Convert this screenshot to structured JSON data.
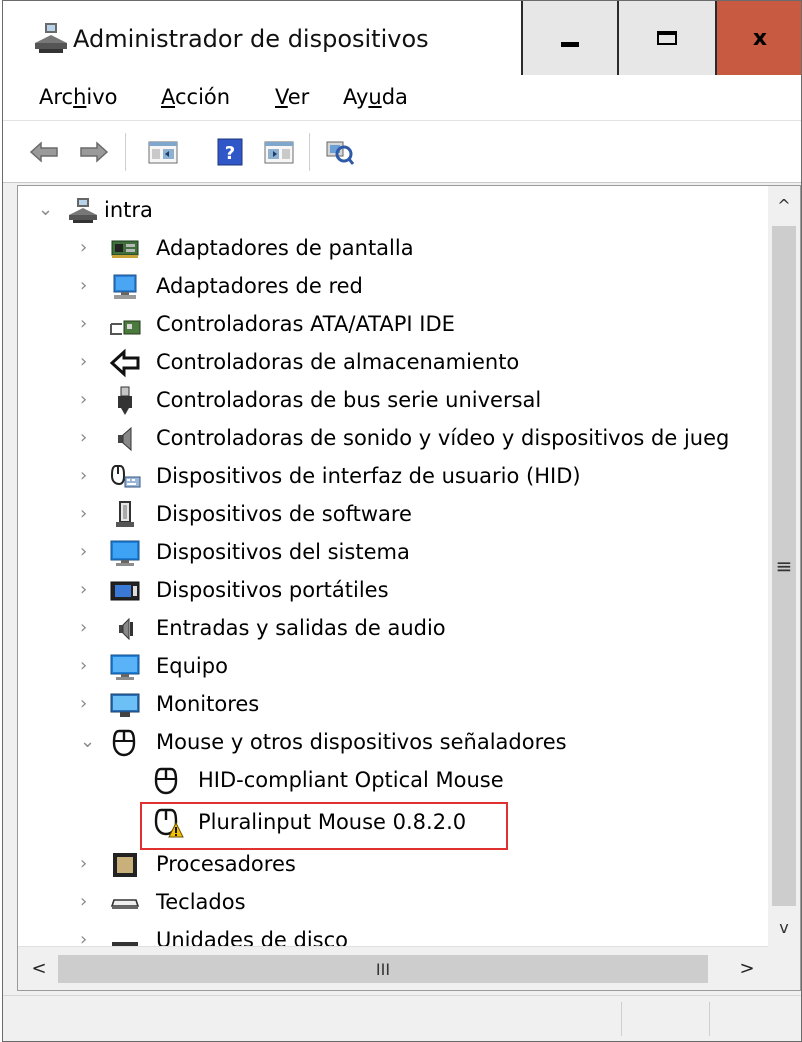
{
  "window": {
    "title": "Administrador de dispositivos",
    "close_glyph": "x",
    "accent_close": "#c75a40"
  },
  "menu": {
    "archivo": {
      "pre": "Arc",
      "u": "h",
      "post": "ivo"
    },
    "accion": {
      "pre": "",
      "u": "A",
      "post": "cción"
    },
    "ver": {
      "pre": "",
      "u": "V",
      "post": "er"
    },
    "ayuda": {
      "pre": "Ay",
      "u": "u",
      "post": "da"
    }
  },
  "toolbar_icons": [
    "back-arrow-icon",
    "forward-arrow-icon",
    "properties-grid-icon",
    "help-icon",
    "view-panel-icon",
    "scan-hardware-icon"
  ],
  "tree": {
    "root": "intra",
    "categories": [
      {
        "label": "Adaptadores de pantalla",
        "icon": "display-adapter-icon"
      },
      {
        "label": "Adaptadores de red",
        "icon": "network-adapter-icon"
      },
      {
        "label": "Controladoras ATA/ATAPI IDE",
        "icon": "ide-controller-icon"
      },
      {
        "label": "Controladoras de almacenamiento",
        "icon": "storage-controller-icon"
      },
      {
        "label": "Controladoras de bus serie universal",
        "icon": "usb-icon"
      },
      {
        "label": "Controladoras de sonido y vídeo y dispositivos de jueg",
        "icon": "speaker-icon"
      },
      {
        "label": "Dispositivos de interfaz de usuario (HID)",
        "icon": "hid-icon"
      },
      {
        "label": "Dispositivos de software",
        "icon": "software-device-icon"
      },
      {
        "label": "Dispositivos del sistema",
        "icon": "system-device-icon"
      },
      {
        "label": "Dispositivos portátiles",
        "icon": "portable-device-icon"
      },
      {
        "label": "Entradas y salidas de audio",
        "icon": "audio-io-icon"
      },
      {
        "label": "Equipo",
        "icon": "computer-icon"
      },
      {
        "label": "Monitores",
        "icon": "monitor-icon"
      },
      {
        "label": "Mouse y otros dispositivos señaladores",
        "icon": "mouse-icon"
      },
      {
        "label": "HID-compliant Optical Mouse",
        "icon": "mouse-icon"
      },
      {
        "label": "Pluralinput Mouse 0.8.2.0",
        "icon": "mouse-warning-icon"
      },
      {
        "label": "Procesadores",
        "icon": "processor-icon"
      },
      {
        "label": "Teclados",
        "icon": "keyboard-icon"
      },
      {
        "label": "Unidades de disco",
        "icon": "disk-drive-icon"
      }
    ]
  },
  "scrollbars": {
    "vertical_grip": "≡",
    "horizontal_grip": "III",
    "up": "^",
    "down": "v",
    "left": "<",
    "right": ">"
  },
  "colors": {
    "highlight_border": "#e0302f",
    "warning": "#f2c200"
  }
}
